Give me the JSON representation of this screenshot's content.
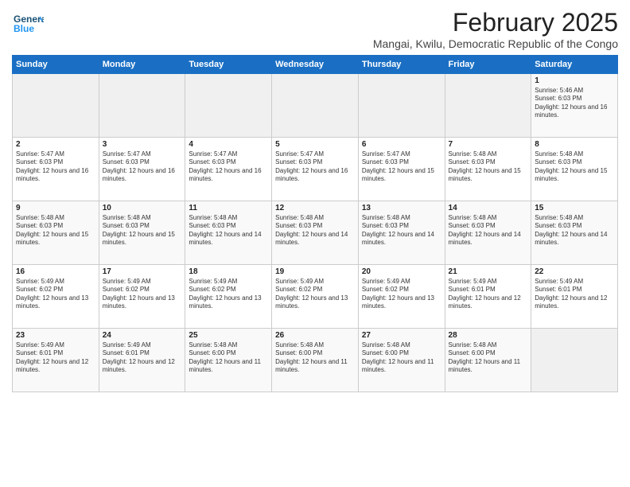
{
  "logo": {
    "line1": "General",
    "line2": "Blue"
  },
  "title": "February 2025",
  "subtitle": "Mangai, Kwilu, Democratic Republic of the Congo",
  "days_of_week": [
    "Sunday",
    "Monday",
    "Tuesday",
    "Wednesday",
    "Thursday",
    "Friday",
    "Saturday"
  ],
  "weeks": [
    [
      {
        "day": "",
        "content": ""
      },
      {
        "day": "",
        "content": ""
      },
      {
        "day": "",
        "content": ""
      },
      {
        "day": "",
        "content": ""
      },
      {
        "day": "",
        "content": ""
      },
      {
        "day": "",
        "content": ""
      },
      {
        "day": "1",
        "content": "Sunrise: 5:46 AM\nSunset: 6:03 PM\nDaylight: 12 hours and 16 minutes."
      }
    ],
    [
      {
        "day": "2",
        "content": "Sunrise: 5:47 AM\nSunset: 6:03 PM\nDaylight: 12 hours and 16 minutes."
      },
      {
        "day": "3",
        "content": "Sunrise: 5:47 AM\nSunset: 6:03 PM\nDaylight: 12 hours and 16 minutes."
      },
      {
        "day": "4",
        "content": "Sunrise: 5:47 AM\nSunset: 6:03 PM\nDaylight: 12 hours and 16 minutes."
      },
      {
        "day": "5",
        "content": "Sunrise: 5:47 AM\nSunset: 6:03 PM\nDaylight: 12 hours and 16 minutes."
      },
      {
        "day": "6",
        "content": "Sunrise: 5:47 AM\nSunset: 6:03 PM\nDaylight: 12 hours and 15 minutes."
      },
      {
        "day": "7",
        "content": "Sunrise: 5:48 AM\nSunset: 6:03 PM\nDaylight: 12 hours and 15 minutes."
      },
      {
        "day": "8",
        "content": "Sunrise: 5:48 AM\nSunset: 6:03 PM\nDaylight: 12 hours and 15 minutes."
      }
    ],
    [
      {
        "day": "9",
        "content": "Sunrise: 5:48 AM\nSunset: 6:03 PM\nDaylight: 12 hours and 15 minutes."
      },
      {
        "day": "10",
        "content": "Sunrise: 5:48 AM\nSunset: 6:03 PM\nDaylight: 12 hours and 15 minutes."
      },
      {
        "day": "11",
        "content": "Sunrise: 5:48 AM\nSunset: 6:03 PM\nDaylight: 12 hours and 14 minutes."
      },
      {
        "day": "12",
        "content": "Sunrise: 5:48 AM\nSunset: 6:03 PM\nDaylight: 12 hours and 14 minutes."
      },
      {
        "day": "13",
        "content": "Sunrise: 5:48 AM\nSunset: 6:03 PM\nDaylight: 12 hours and 14 minutes."
      },
      {
        "day": "14",
        "content": "Sunrise: 5:48 AM\nSunset: 6:03 PM\nDaylight: 12 hours and 14 minutes."
      },
      {
        "day": "15",
        "content": "Sunrise: 5:48 AM\nSunset: 6:03 PM\nDaylight: 12 hours and 14 minutes."
      }
    ],
    [
      {
        "day": "16",
        "content": "Sunrise: 5:49 AM\nSunset: 6:02 PM\nDaylight: 12 hours and 13 minutes."
      },
      {
        "day": "17",
        "content": "Sunrise: 5:49 AM\nSunset: 6:02 PM\nDaylight: 12 hours and 13 minutes."
      },
      {
        "day": "18",
        "content": "Sunrise: 5:49 AM\nSunset: 6:02 PM\nDaylight: 12 hours and 13 minutes."
      },
      {
        "day": "19",
        "content": "Sunrise: 5:49 AM\nSunset: 6:02 PM\nDaylight: 12 hours and 13 minutes."
      },
      {
        "day": "20",
        "content": "Sunrise: 5:49 AM\nSunset: 6:02 PM\nDaylight: 12 hours and 13 minutes."
      },
      {
        "day": "21",
        "content": "Sunrise: 5:49 AM\nSunset: 6:01 PM\nDaylight: 12 hours and 12 minutes."
      },
      {
        "day": "22",
        "content": "Sunrise: 5:49 AM\nSunset: 6:01 PM\nDaylight: 12 hours and 12 minutes."
      }
    ],
    [
      {
        "day": "23",
        "content": "Sunrise: 5:49 AM\nSunset: 6:01 PM\nDaylight: 12 hours and 12 minutes."
      },
      {
        "day": "24",
        "content": "Sunrise: 5:49 AM\nSunset: 6:01 PM\nDaylight: 12 hours and 12 minutes."
      },
      {
        "day": "25",
        "content": "Sunrise: 5:48 AM\nSunset: 6:00 PM\nDaylight: 12 hours and 11 minutes."
      },
      {
        "day": "26",
        "content": "Sunrise: 5:48 AM\nSunset: 6:00 PM\nDaylight: 12 hours and 11 minutes."
      },
      {
        "day": "27",
        "content": "Sunrise: 5:48 AM\nSunset: 6:00 PM\nDaylight: 12 hours and 11 minutes."
      },
      {
        "day": "28",
        "content": "Sunrise: 5:48 AM\nSunset: 6:00 PM\nDaylight: 12 hours and 11 minutes."
      },
      {
        "day": "",
        "content": ""
      }
    ]
  ]
}
